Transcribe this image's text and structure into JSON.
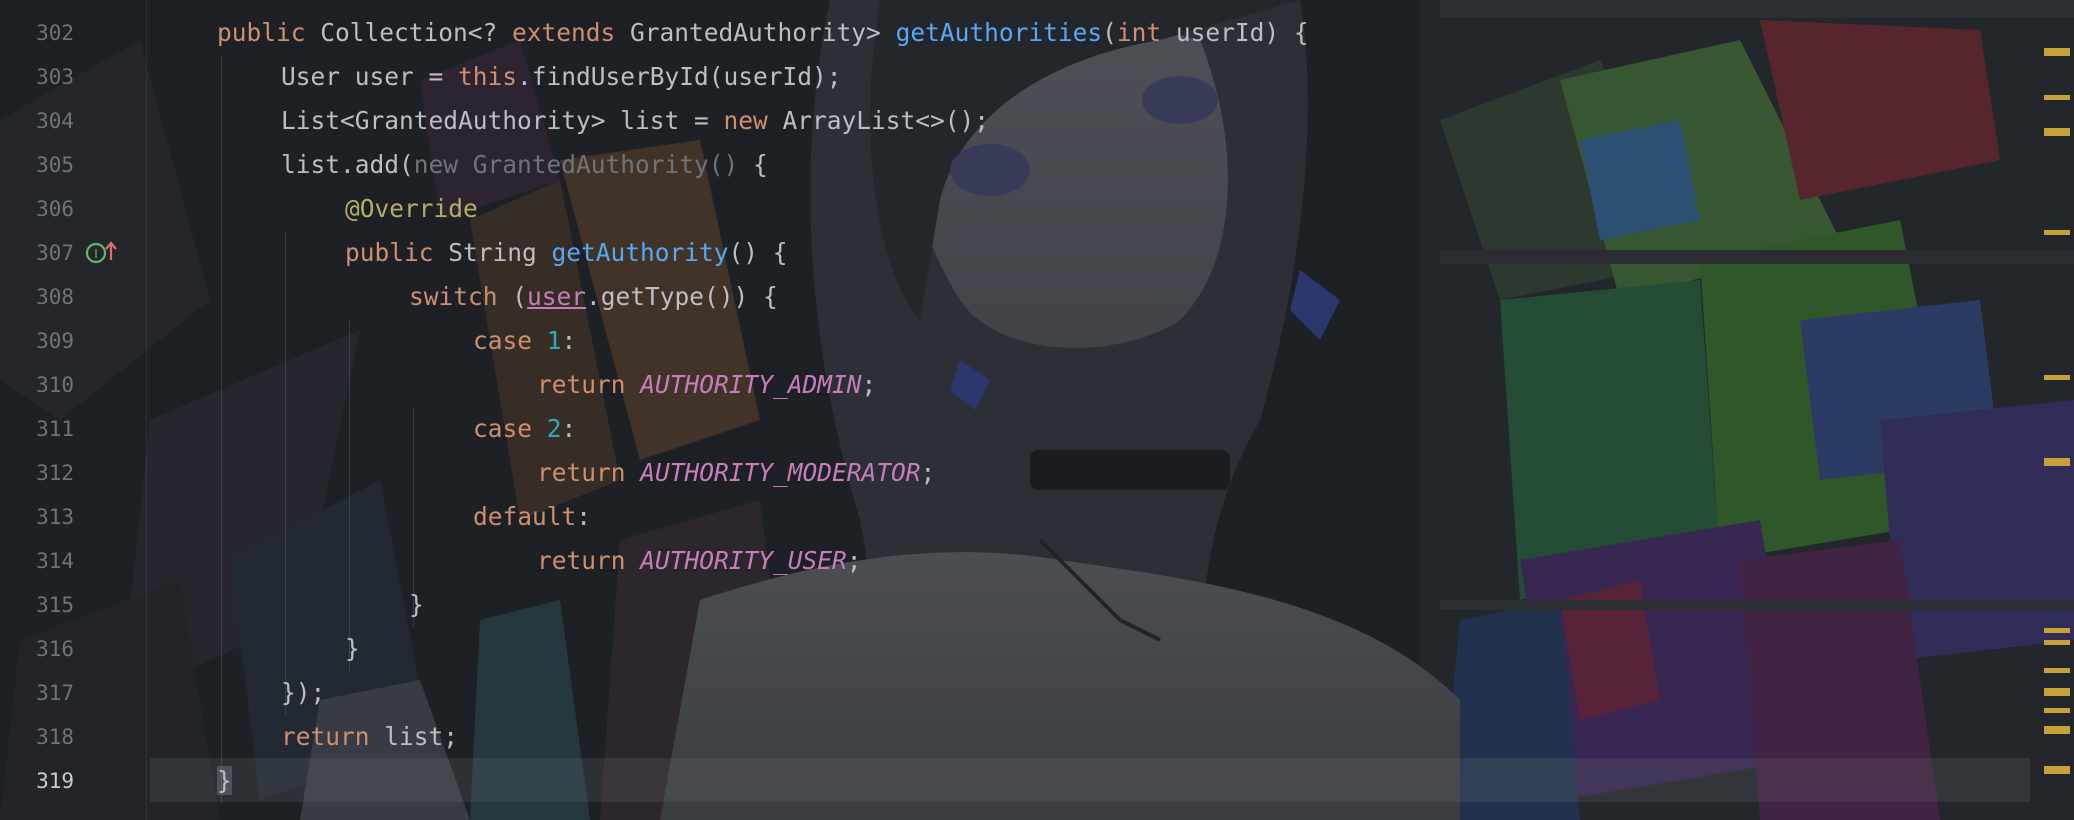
{
  "editor": {
    "current_line": "319",
    "implements_marker": "implements-method",
    "lines": [
      {
        "number": "302",
        "indent": 0,
        "tokens": [
          {
            "t": "public ",
            "c": "kw"
          },
          {
            "t": "Collection<? ",
            "c": ""
          },
          {
            "t": "extends ",
            "c": "kw"
          },
          {
            "t": "GrantedAuthority> ",
            "c": ""
          },
          {
            "t": "getAuthorities",
            "c": "fn"
          },
          {
            "t": "(",
            "c": ""
          },
          {
            "t": "int ",
            "c": "kw"
          },
          {
            "t": "userId) {",
            "c": ""
          }
        ]
      },
      {
        "number": "303",
        "indent": 1,
        "tokens": [
          {
            "t": "User user = ",
            "c": ""
          },
          {
            "t": "this",
            "c": "kw"
          },
          {
            "t": ".findUserById(userId);",
            "c": ""
          }
        ]
      },
      {
        "number": "304",
        "indent": 1,
        "tokens": [
          {
            "t": "List<GrantedAuthority> list = ",
            "c": ""
          },
          {
            "t": "new ",
            "c": "kw"
          },
          {
            "t": "ArrayList<>();",
            "c": ""
          }
        ]
      },
      {
        "number": "305",
        "indent": 1,
        "tokens": [
          {
            "t": "list.add(",
            "c": ""
          },
          {
            "t": "new GrantedAuthority()",
            "c": "dim"
          },
          {
            "t": " {",
            "c": ""
          }
        ]
      },
      {
        "number": "306",
        "indent": 2,
        "tokens": [
          {
            "t": "@Override",
            "c": "ann"
          }
        ]
      },
      {
        "number": "307",
        "indent": 2,
        "tokens": [
          {
            "t": "public ",
            "c": "kw"
          },
          {
            "t": "String ",
            "c": ""
          },
          {
            "t": "getAuthority",
            "c": "fn"
          },
          {
            "t": "() {",
            "c": ""
          }
        ]
      },
      {
        "number": "308",
        "indent": 3,
        "tokens": [
          {
            "t": "switch ",
            "c": "kw"
          },
          {
            "t": "(",
            "c": ""
          },
          {
            "t": "user",
            "c": "fld"
          },
          {
            "t": ".getType()) {",
            "c": ""
          }
        ]
      },
      {
        "number": "309",
        "indent": 4,
        "tokens": [
          {
            "t": "case ",
            "c": "kw"
          },
          {
            "t": "1",
            "c": "num"
          },
          {
            "t": ":",
            "c": ""
          }
        ]
      },
      {
        "number": "310",
        "indent": 5,
        "tokens": [
          {
            "t": "return ",
            "c": "kw"
          },
          {
            "t": "AUTHORITY_ADMIN",
            "c": "const"
          },
          {
            "t": ";",
            "c": ""
          }
        ]
      },
      {
        "number": "311",
        "indent": 4,
        "tokens": [
          {
            "t": "case ",
            "c": "kw"
          },
          {
            "t": "2",
            "c": "num"
          },
          {
            "t": ":",
            "c": ""
          }
        ]
      },
      {
        "number": "312",
        "indent": 5,
        "tokens": [
          {
            "t": "return ",
            "c": "kw"
          },
          {
            "t": "AUTHORITY_MODERATOR",
            "c": "const"
          },
          {
            "t": ";",
            "c": ""
          }
        ]
      },
      {
        "number": "313",
        "indent": 4,
        "tokens": [
          {
            "t": "default",
            "c": "kw"
          },
          {
            "t": ":",
            "c": ""
          }
        ]
      },
      {
        "number": "314",
        "indent": 5,
        "tokens": [
          {
            "t": "return ",
            "c": "kw"
          },
          {
            "t": "AUTHORITY_USER",
            "c": "const"
          },
          {
            "t": ";",
            "c": ""
          }
        ]
      },
      {
        "number": "315",
        "indent": 3,
        "tokens": [
          {
            "t": "}",
            "c": ""
          }
        ]
      },
      {
        "number": "316",
        "indent": 2,
        "tokens": [
          {
            "t": "}",
            "c": ""
          }
        ]
      },
      {
        "number": "317",
        "indent": 1,
        "tokens": [
          {
            "t": "});",
            "c": ""
          }
        ]
      },
      {
        "number": "318",
        "indent": 1,
        "tokens": [
          {
            "t": "return ",
            "c": "kw"
          },
          {
            "t": "list;",
            "c": ""
          }
        ]
      },
      {
        "number": "319",
        "indent": 0,
        "tokens": [
          {
            "t": "}",
            "c": "caret-char"
          }
        ]
      }
    ]
  },
  "colors": {
    "keyword": "#cf8e6d",
    "function": "#56a8f5",
    "number": "#2aacb8",
    "constant": "#c77dbb",
    "annotation": "#b3ae60",
    "text": "#bcbec4",
    "line_number": "#6f737a",
    "scroll_marker": "#c7a23a"
  },
  "icons": {
    "gutter": "implemented-method-icon",
    "wallpaper": "anime-girl-graffiti-wallpaper"
  }
}
